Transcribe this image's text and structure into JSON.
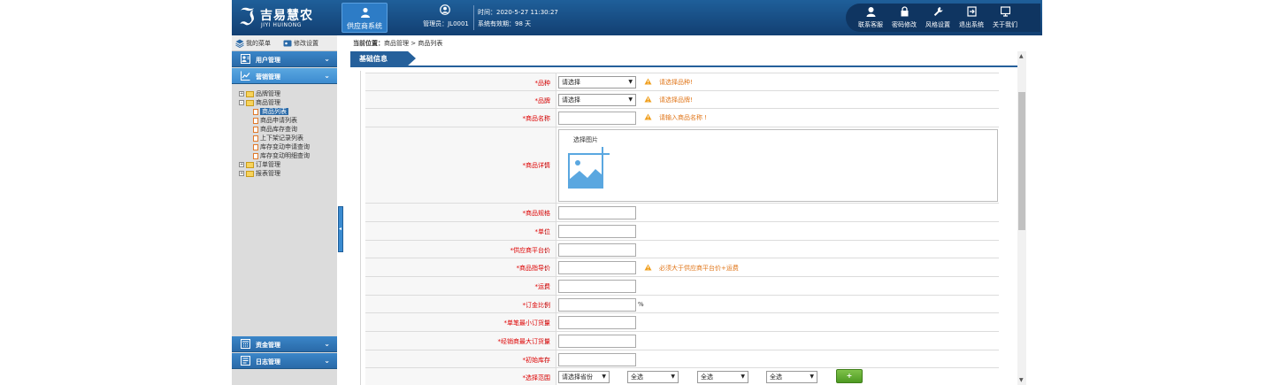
{
  "header": {
    "logo_name": "吉易慧农",
    "logo_sub": "JIYI HUINONG",
    "supplier_tab": "供应商系统",
    "user_label": "管理员：JL0001",
    "time_label": "时间：2020-5-27 11:30:27",
    "validity_label": "系统有效期：98 天",
    "actions": [
      {
        "label": "联系客服",
        "icon": "headset-icon"
      },
      {
        "label": "密码修改",
        "icon": "lock-icon"
      },
      {
        "label": "风格设置",
        "icon": "wrench-icon"
      },
      {
        "label": "退出系统",
        "icon": "exit-icon"
      },
      {
        "label": "关于我们",
        "icon": "monitor-icon"
      }
    ]
  },
  "sidebar": {
    "my_menu": "我的菜单",
    "modify_settings": "修改设置",
    "sections": [
      {
        "label": "用户管理"
      },
      {
        "label": "营销管理"
      },
      {
        "label": "资金管理"
      },
      {
        "label": "日志管理"
      }
    ],
    "tree": [
      {
        "label": "品牌管理",
        "kind": "folder",
        "expander": "+"
      },
      {
        "label": "商品管理",
        "kind": "folder",
        "expander": "-"
      },
      {
        "label": "商品列表",
        "kind": "leaf"
      },
      {
        "label": "商品申请列表",
        "kind": "leaf"
      },
      {
        "label": "商品库存查询",
        "kind": "leaf"
      },
      {
        "label": "上下架记录列表",
        "kind": "leaf"
      },
      {
        "label": "库存变动申请查询",
        "kind": "leaf"
      },
      {
        "label": "库存变动明细查询",
        "kind": "leaf"
      },
      {
        "label": "订单管理",
        "kind": "folder",
        "expander": "+"
      },
      {
        "label": "报表管理",
        "kind": "folder",
        "expander": "+"
      }
    ]
  },
  "main": {
    "breadcrumb_prefix": "当前位置：",
    "breadcrumb_path": "商品管理 > 商品列表",
    "section_title": "基础信息",
    "form": {
      "variety": {
        "label": "*品种",
        "colon": "：",
        "select": "请选择",
        "warning": "请选择品种!"
      },
      "brand": {
        "label": "*品牌",
        "colon": "：",
        "select": "请选择",
        "warning": "请选择品牌!"
      },
      "product_name": {
        "label": "*商品名称",
        "colon": "：",
        "value": "",
        "warning": "请输入商品名称 !"
      },
      "product_detail": {
        "label": "*商品详情",
        "colon": "：",
        "select_image": "选择图片"
      },
      "spec": {
        "label": "*商品规格",
        "colon": "：",
        "value": ""
      },
      "unit": {
        "label": "*单位",
        "colon": "：",
        "value": ""
      },
      "supplier_price": {
        "label": "*供应商平台价",
        "colon": "：",
        "value": ""
      },
      "guide_price": {
        "label": "*商品指导价",
        "colon": "：",
        "value": "",
        "warning": "必须大于供应商平台价+运费"
      },
      "freight": {
        "label": "*运费",
        "colon": "：",
        "value": ""
      },
      "deposit_ratio": {
        "label": "*订金比例",
        "colon": "：",
        "value": "",
        "unit": "%"
      },
      "min_order": {
        "label": "*单笔最小订货量",
        "colon": "：",
        "value": ""
      },
      "max_order": {
        "label": "*经销商最大订货量",
        "colon": "：",
        "value": ""
      },
      "initial_stock": {
        "label": "*初始库存",
        "colon": "：",
        "value": ""
      },
      "range": {
        "label": "*选择范围",
        "colon": "：",
        "province": "请选择省份",
        "all1": "全选",
        "all2": "全选",
        "all3": "全选",
        "add": "+"
      }
    }
  },
  "colors": {
    "header_bg": "#1a4f86",
    "accent": "#2a6aa8",
    "warning": "#e0761a",
    "required": "#d00000",
    "add_button": "#5fa82f"
  }
}
